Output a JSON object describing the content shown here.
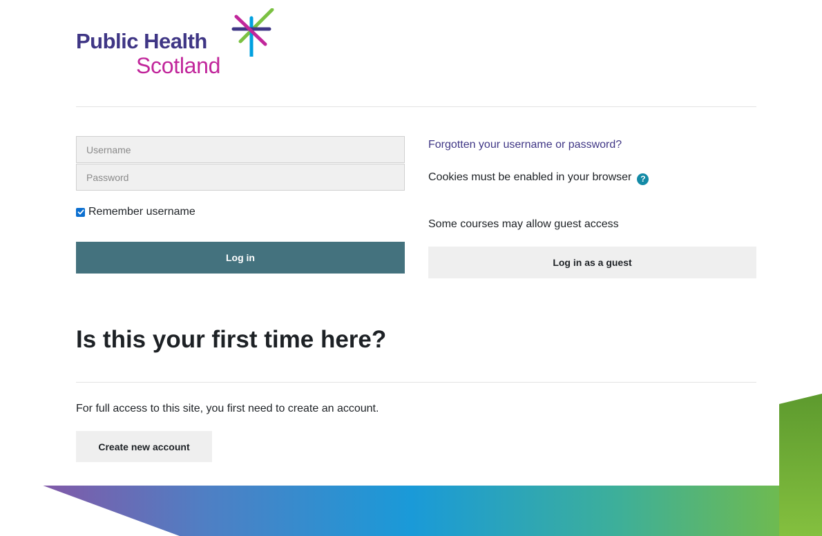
{
  "brand": {
    "line1": "Public Health",
    "line2": "Scotland",
    "star_colors": [
      "#7bc142",
      "#00a0e0",
      "#c1269b",
      "#3f3685"
    ],
    "text_color_primary": "#3f3685",
    "text_color_secondary": "#c1269b"
  },
  "login": {
    "username_placeholder": "Username",
    "password_placeholder": "Password",
    "remember_label": "Remember username",
    "remember_checked": true,
    "login_button": "Log in"
  },
  "side": {
    "forgot_link": "Forgotten your username or password?",
    "cookies_text": "Cookies must be enabled in your browser",
    "help_icon_glyph": "?",
    "guest_text": "Some courses may allow guest access",
    "guest_button": "Log in as a guest"
  },
  "signup": {
    "heading": "Is this your first time here?",
    "description": "For full access to this site, you first need to create an account.",
    "create_button": "Create new account"
  },
  "colors": {
    "primary_button": "#44727e",
    "secondary_button": "#efefef",
    "link": "#3f3685",
    "help_icon": "#138aa6",
    "checkbox": "#0b6fd0"
  }
}
